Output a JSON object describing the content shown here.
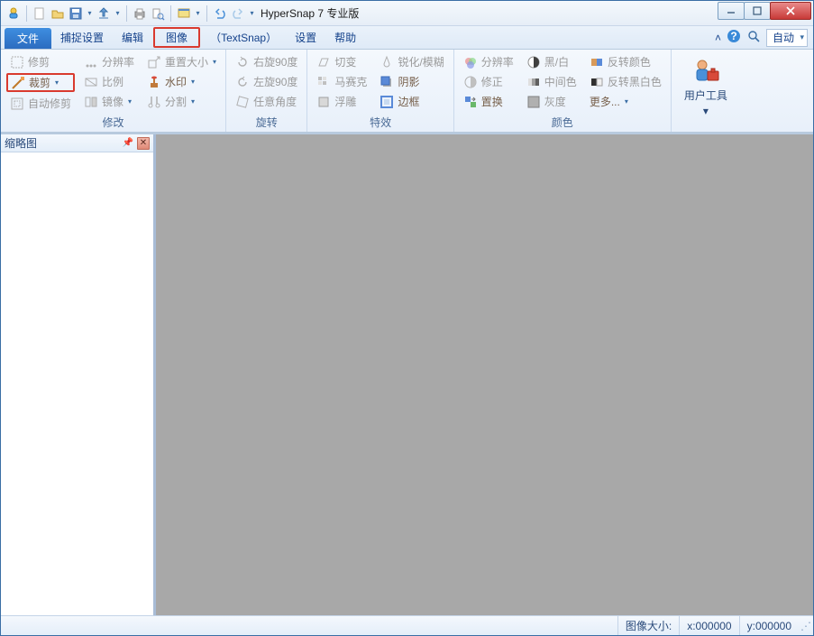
{
  "window": {
    "title": "HyperSnap 7 专业版"
  },
  "tabs": {
    "file": "文件",
    "capture_settings": "捕捉设置",
    "edit": "编辑",
    "image": "图像",
    "textsnap": "（TextSnap）",
    "settings": "设置",
    "help": "帮助"
  },
  "tabrow_right": {
    "auto_label": "自动"
  },
  "ribbon": {
    "modify": {
      "label": "修改",
      "trim": "修剪",
      "crop": "裁剪",
      "auto_trim": "自动修剪",
      "resolution": "分辨率",
      "ratio": "比例",
      "mirror": "镜像",
      "resize": "重置大小",
      "watermark": "水印",
      "split": "分割"
    },
    "rotate": {
      "label": "旋转",
      "right90": "右旋90度",
      "left90": "左旋90度",
      "any_angle": "任意角度"
    },
    "effects": {
      "label": "特效",
      "shear": "切变",
      "mosaic": "马赛克",
      "emboss": "浮雕",
      "sharpen_blur": "锐化/模糊",
      "shadow": "阴影",
      "border": "边框"
    },
    "color": {
      "label": "颜色",
      "resolution": "分辨率",
      "correction": "修正",
      "replace": "置换",
      "bw": "黑/白",
      "midtone": "中间色",
      "gray": "灰度",
      "invert": "反转颜色",
      "invert_bw": "反转黑白色",
      "more": "更多..."
    },
    "user_tools": {
      "label": "用户工具"
    }
  },
  "side": {
    "thumbnails": "缩略图"
  },
  "status": {
    "image_size": "图像大小:",
    "x": "x:000000",
    "y": "y:000000"
  }
}
